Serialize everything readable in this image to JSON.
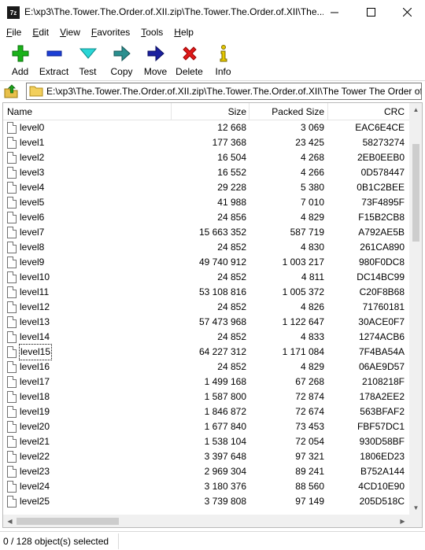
{
  "window": {
    "title": "E:\\xp3\\The.Tower.The.Order.of.XII.zip\\The.Tower.The.Order.of.XII\\The...",
    "app_icon_text": "7z",
    "minimize": "—",
    "maximize": "☐",
    "close": "✕"
  },
  "menu": [
    {
      "label": "File",
      "u": "F",
      "rest": "ile"
    },
    {
      "label": "Edit",
      "u": "E",
      "rest": "dit"
    },
    {
      "label": "View",
      "u": "V",
      "rest": "iew"
    },
    {
      "label": "Favorites",
      "u": "F",
      "rest": "avorites"
    },
    {
      "label": "Tools",
      "u": "T",
      "rest": "ools"
    },
    {
      "label": "Help",
      "u": "H",
      "rest": "elp"
    }
  ],
  "toolbar": {
    "add": "Add",
    "extract": "Extract",
    "test": "Test",
    "copy": "Copy",
    "move": "Move",
    "delete": "Delete",
    "info": "Info"
  },
  "address": {
    "path": "E:\\xp3\\The.Tower.The.Order.of.XII.zip\\The.Tower.The.Order.of.XII\\The Tower The Order of"
  },
  "columns": {
    "name": "Name",
    "size": "Size",
    "packed": "Packed Size",
    "crc": "CRC"
  },
  "files": [
    {
      "name": "level0",
      "size": "12 668",
      "packed": "3 069",
      "crc": "EAC6E4CE"
    },
    {
      "name": "level1",
      "size": "177 368",
      "packed": "23 425",
      "crc": "58273274"
    },
    {
      "name": "level2",
      "size": "16 504",
      "packed": "4 268",
      "crc": "2EB0EEB0"
    },
    {
      "name": "level3",
      "size": "16 552",
      "packed": "4 266",
      "crc": "0D578447"
    },
    {
      "name": "level4",
      "size": "29 228",
      "packed": "5 380",
      "crc": "0B1C2BEE"
    },
    {
      "name": "level5",
      "size": "41 988",
      "packed": "7 010",
      "crc": "73F4895F"
    },
    {
      "name": "level6",
      "size": "24 856",
      "packed": "4 829",
      "crc": "F15B2CB8"
    },
    {
      "name": "level7",
      "size": "15 663 352",
      "packed": "587 719",
      "crc": "A792AE5B"
    },
    {
      "name": "level8",
      "size": "24 852",
      "packed": "4 830",
      "crc": "261CA890"
    },
    {
      "name": "level9",
      "size": "49 740 912",
      "packed": "1 003 217",
      "crc": "980F0DC8"
    },
    {
      "name": "level10",
      "size": "24 852",
      "packed": "4 811",
      "crc": "DC14BC99"
    },
    {
      "name": "level11",
      "size": "53 108 816",
      "packed": "1 005 372",
      "crc": "C20F8B68"
    },
    {
      "name": "level12",
      "size": "24 852",
      "packed": "4 826",
      "crc": "71760181"
    },
    {
      "name": "level13",
      "size": "57 473 968",
      "packed": "1 122 647",
      "crc": "30ACE0F7"
    },
    {
      "name": "level14",
      "size": "24 852",
      "packed": "4 833",
      "crc": "1274ACB6"
    },
    {
      "name": "level15",
      "size": "64 227 312",
      "packed": "1 171 084",
      "crc": "7F4BA54A"
    },
    {
      "name": "level16",
      "size": "24 852",
      "packed": "4 829",
      "crc": "06AE9D57"
    },
    {
      "name": "level17",
      "size": "1 499 168",
      "packed": "67 268",
      "crc": "2108218F"
    },
    {
      "name": "level18",
      "size": "1 587 800",
      "packed": "72 874",
      "crc": "178A2EE2"
    },
    {
      "name": "level19",
      "size": "1 846 872",
      "packed": "72 674",
      "crc": "563BFAF2"
    },
    {
      "name": "level20",
      "size": "1 677 840",
      "packed": "73 453",
      "crc": "FBF57DC1"
    },
    {
      "name": "level21",
      "size": "1 538 104",
      "packed": "72 054",
      "crc": "930D58BF"
    },
    {
      "name": "level22",
      "size": "3 397 648",
      "packed": "97 321",
      "crc": "1806ED23"
    },
    {
      "name": "level23",
      "size": "2 969 304",
      "packed": "89 241",
      "crc": "B752A144"
    },
    {
      "name": "level24",
      "size": "3 180 376",
      "packed": "88 560",
      "crc": "4CD10E90"
    },
    {
      "name": "level25",
      "size": "3 739 808",
      "packed": "97 149",
      "crc": "205D518C"
    }
  ],
  "focused_row": "level15",
  "status": {
    "selection": "0 / 128 object(s) selected"
  }
}
